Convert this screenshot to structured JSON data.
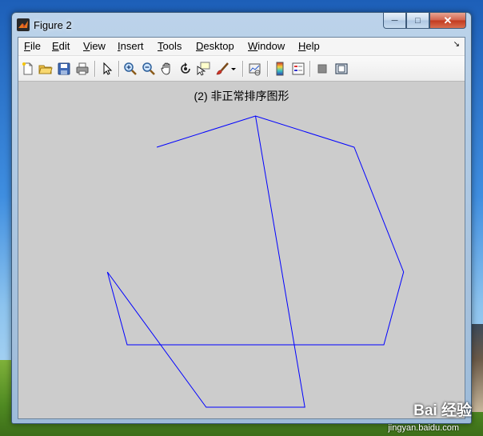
{
  "window": {
    "title": "Figure 2",
    "caption": {
      "minimize": "─",
      "maximize": "□",
      "close": "✕"
    }
  },
  "menu": [
    "File",
    "Edit",
    "View",
    "Insert",
    "Tools",
    "Desktop",
    "Window",
    "Help"
  ],
  "dock_glyph": "↘",
  "toolbar": {
    "buttons": [
      {
        "icon": "new-figure-icon"
      },
      {
        "icon": "open-file-icon"
      },
      {
        "icon": "save-icon"
      },
      {
        "icon": "print-icon"
      },
      {
        "icon": "edit-plot-arrow-icon"
      },
      {
        "icon": "zoom-in-icon"
      },
      {
        "icon": "zoom-out-icon"
      },
      {
        "icon": "pan-hand-icon"
      },
      {
        "icon": "rotate-3d-icon"
      },
      {
        "icon": "data-cursor-icon"
      },
      {
        "icon": "brush-icon"
      },
      {
        "icon": "link-plot-icon"
      },
      {
        "icon": "colorbar-icon"
      },
      {
        "icon": "legend-icon"
      },
      {
        "icon": "hide-plot-tools-icon"
      },
      {
        "icon": "show-plot-tools-icon"
      }
    ]
  },
  "plot": {
    "title": "(2) 非正常排序图形",
    "line_color": "#0000ff",
    "background": "#cccccc"
  },
  "chart_data": {
    "type": "line",
    "title": "(2) 非正常排序图形",
    "xlabel": "",
    "ylabel": "",
    "grid": false,
    "axes_visible": false,
    "x": [
      -1.0,
      0.0,
      1.0,
      1.5,
      1.3,
      -1.3,
      -1.5,
      -0.5,
      0.5,
      0.0,
      -1.0,
      0.0,
      1.0
    ],
    "y": [
      3.7,
      4.0,
      3.7,
      2.5,
      1.8,
      1.8,
      2.5,
      1.2,
      1.2,
      4.0,
      3.7,
      4.0,
      3.7
    ],
    "xlim": [
      -1.6,
      1.6
    ],
    "ylim": [
      1.1,
      4.1
    ]
  },
  "watermark": {
    "brand": "Bai 经验",
    "url": "jingyan.baidu.com"
  }
}
